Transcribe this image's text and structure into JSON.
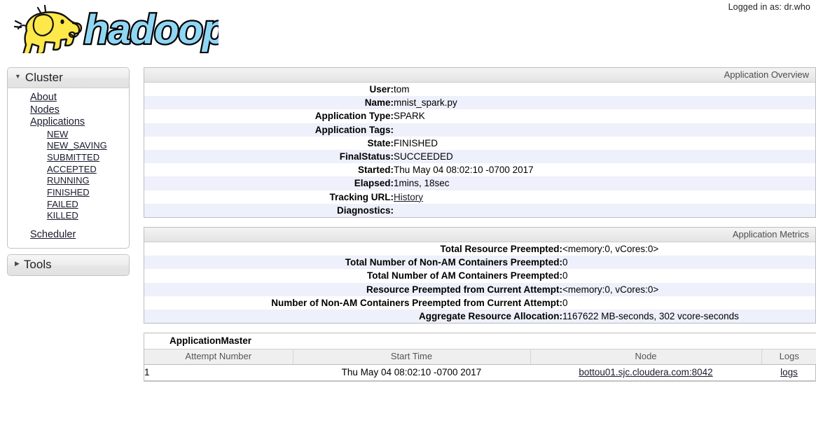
{
  "header": {
    "logged_in_text": "Logged in as: dr.who",
    "logo_text": "hadoop",
    "logo_icon": "hadoop-elephant-logo"
  },
  "sidebar": {
    "cluster": {
      "title": "Cluster",
      "expand_icon": "caret-down-icon",
      "items": [
        {
          "label": "About",
          "level": 0
        },
        {
          "label": "Nodes",
          "level": 0
        },
        {
          "label": "Applications",
          "level": 0
        },
        {
          "label": "NEW",
          "level": 1
        },
        {
          "label": "NEW_SAVING",
          "level": 1
        },
        {
          "label": "SUBMITTED",
          "level": 1
        },
        {
          "label": "ACCEPTED",
          "level": 1
        },
        {
          "label": "RUNNING",
          "level": 1
        },
        {
          "label": "FINISHED",
          "level": 1
        },
        {
          "label": "FAILED",
          "level": 1
        },
        {
          "label": "KILLED",
          "level": 1
        },
        {
          "label": "Scheduler",
          "level": 0
        }
      ]
    },
    "tools": {
      "title": "Tools",
      "expand_icon": "caret-right-icon"
    }
  },
  "application_overview": {
    "title": "Application Overview",
    "rows": [
      {
        "key": "User:",
        "value": "tom",
        "link": false
      },
      {
        "key": "Name:",
        "value": "mnist_spark.py",
        "link": false
      },
      {
        "key": "Application Type:",
        "value": "SPARK",
        "link": false
      },
      {
        "key": "Application Tags:",
        "value": "",
        "link": false
      },
      {
        "key": "State:",
        "value": "FINISHED",
        "link": false
      },
      {
        "key": "FinalStatus:",
        "value": "SUCCEEDED",
        "link": false
      },
      {
        "key": "Started:",
        "value": "Thu May 04 08:02:10 -0700 2017",
        "link": false
      },
      {
        "key": "Elapsed:",
        "value": "1mins, 18sec",
        "link": false
      },
      {
        "key": "Tracking URL:",
        "value": "History",
        "link": true
      },
      {
        "key": "Diagnostics:",
        "value": "",
        "link": false
      }
    ]
  },
  "application_metrics": {
    "title": "Application Metrics",
    "rows": [
      {
        "key": "Total Resource Preempted:",
        "value": "<memory:0, vCores:0>"
      },
      {
        "key": "Total Number of Non-AM Containers Preempted:",
        "value": "0"
      },
      {
        "key": "Total Number of AM Containers Preempted:",
        "value": "0"
      },
      {
        "key": "Resource Preempted from Current Attempt:",
        "value": "<memory:0, vCores:0>"
      },
      {
        "key": "Number of Non-AM Containers Preempted from Current Attempt:",
        "value": "0"
      },
      {
        "key": "Aggregate Resource Allocation:",
        "value": "1167622 MB-seconds, 302 vcore-seconds"
      }
    ]
  },
  "application_master": {
    "caption": "ApplicationMaster",
    "columns": [
      "Attempt Number",
      "Start Time",
      "Node",
      "Logs"
    ],
    "rows": [
      {
        "attempt": "1",
        "start_time": "Thu May 04 08:02:10 -0700 2017",
        "node": "bottou01.sjc.cloudera.com:8042",
        "logs": "logs"
      }
    ]
  },
  "colors": {
    "row_alt": "#eef0fb",
    "logo_yellow": "#ffe84a",
    "logo_blue": "#8fd6f4",
    "panel_border": "#c3c3c3"
  }
}
